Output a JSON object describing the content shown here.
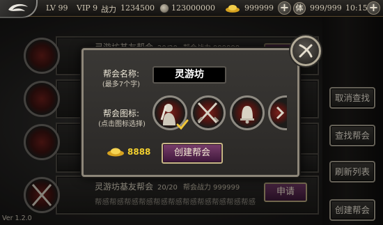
{
  "topbar": {
    "level": "LV 99",
    "vip": "VIP 9",
    "power_label": "战力",
    "power_value": "1234500",
    "coins": "123000000",
    "gold": "999999",
    "stamina_icon_text": "体",
    "stamina": "999/999",
    "time": "10:15"
  },
  "guild_list": {
    "rows": [
      {
        "name": "灵游坊基友帮会",
        "members": "20/20",
        "power_label": "帮会战力",
        "power": "999999",
        "desc": "",
        "apply_label": "申请"
      },
      {
        "name": "",
        "members": "",
        "power_label": "",
        "power": "",
        "desc": "",
        "apply_label": ""
      },
      {
        "name": "",
        "members": "",
        "power_label": "",
        "power": "",
        "desc": "",
        "apply_label": ""
      },
      {
        "name": "",
        "members": "",
        "power_label": "",
        "power": "",
        "desc": "",
        "apply_label": ""
      },
      {
        "name": "灵游坊基友帮会",
        "members": "20/20",
        "power_label": "帮会战力",
        "power": "999999",
        "desc": "帮感帮感帮感帮感帮感帮感帮感帮感帮感帮感帮感",
        "apply_label": "申请"
      }
    ]
  },
  "side_buttons": {
    "cancel_search": "取消查找",
    "search_guild": "查找帮会",
    "refresh_list": "刷新列表",
    "create_guild": "创建帮会"
  },
  "dialog": {
    "name_label": "帮会名称:",
    "name_hint": "(最多7个字)",
    "name_value": "灵游坊",
    "icon_label": "帮会图标:",
    "icon_hint": "(点击图标选择)",
    "emblems": [
      "female-warrior-emblem",
      "crossed-swords-emblem",
      "bell-emblem",
      "partial-emblem"
    ],
    "selected_emblem": 0,
    "cost": "8888",
    "create_label": "创建帮会"
  },
  "version": "Ver 1.2.0"
}
